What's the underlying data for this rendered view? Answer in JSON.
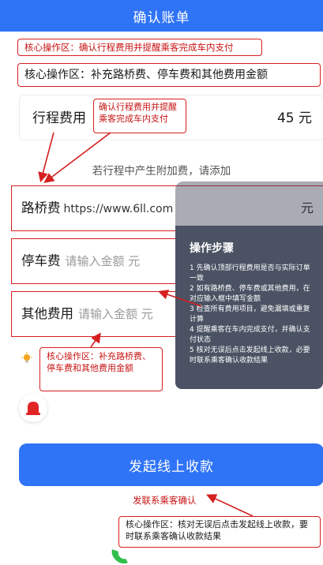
{
  "header": {
    "title": "确认账单"
  },
  "annotations": {
    "top_primary": "核心操作区：确认行程费用并提醒乘客完成车内支付",
    "top_secondary": "核心操作区：补充路桥费、停车费和其他费用金额",
    "fare_note": "确认行程费用并提醒乘客完成车内支付",
    "left_note": "核心操作区：补充路桥费、停车费和其他费用金额",
    "bottom_note": "核心操作区：核对无误后点击发起线上收款，要时联系乘客确认收款结果"
  },
  "fare": {
    "label": "行程费用",
    "amount": "45 元"
  },
  "surcharge_hint": "若行程中产生附加费，请添加",
  "fees": [
    {
      "label": "路桥费",
      "value": "https://www.6ll.com",
      "placeholder": "",
      "unit": "元"
    },
    {
      "label": "停车费",
      "value": "",
      "placeholder": "请输入金额 元",
      "unit": "元"
    },
    {
      "label": "其他费用",
      "value": "",
      "placeholder": "请输入金额 元",
      "unit": "元"
    }
  ],
  "tooltip": {
    "title": "操作步骤",
    "steps": [
      "1 先确认顶部行程费用是否与实际订单一致",
      "2 如有路桥费、停车费或其他费用，在对应输入框中填写金额",
      "3 检查所有费用项目，避免漏填或重复计算",
      "4 提醒乘客在车内完成支付，并确认支付状态",
      "5 核对无误后点击发起线上收款，必要时联系乘客确认收款结果"
    ]
  },
  "submit": {
    "label": "发起线上收款"
  },
  "contact_note": "发联系乘客确认",
  "colors": {
    "brand": "#2f73f6",
    "annotation": "#d61f1f",
    "tooltip_bg": "#4a5263"
  },
  "icons": {
    "bulb": "lightbulb-icon",
    "alarm": "alarm-icon",
    "phone": "phone-icon"
  }
}
